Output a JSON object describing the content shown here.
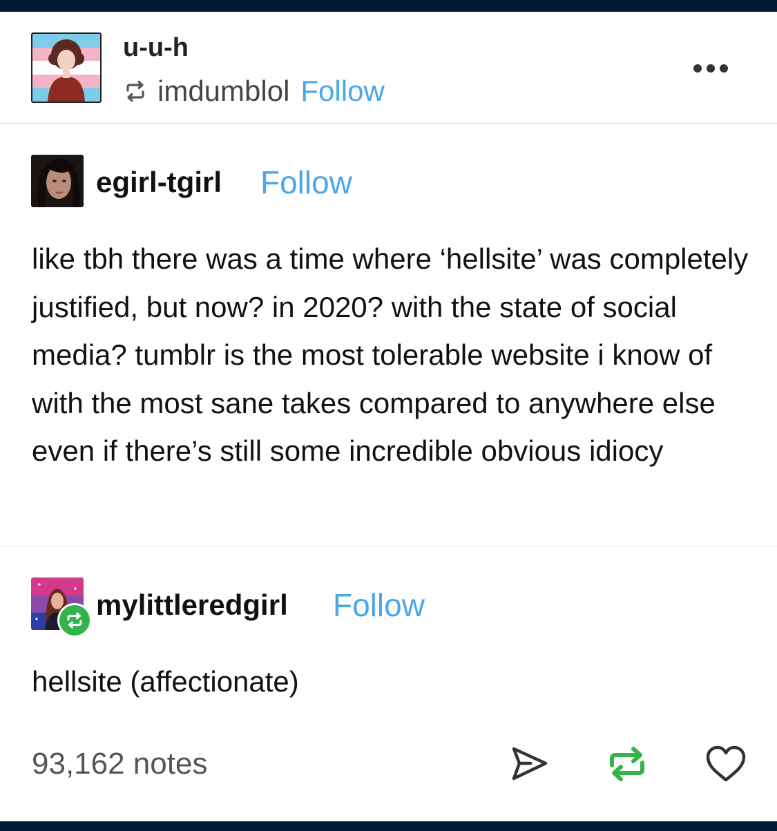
{
  "header": {
    "blog_name": "u-u-h",
    "reblogged_from": "imdumblol",
    "follow_label": "Follow"
  },
  "trail": [
    {
      "username": "egirl-tgirl",
      "follow_label": "Follow",
      "body": "like tbh there was a time where ‘hellsite’ was completely justified, but now? in 2020? with the state of social media? tumblr is the most tolerable website i know of with the most sane takes compared to anywhere else even if there’s still some incredible obvious idiocy"
    },
    {
      "username": "mylittleredgirl",
      "follow_label": "Follow",
      "body": "hellsite (affectionate)"
    }
  ],
  "footer": {
    "notes": "93,162 notes",
    "actions": [
      "share-icon",
      "reblog-icon",
      "like-icon"
    ]
  },
  "colors": {
    "nav_background": "#001935",
    "follow_link": "#4ba7e8",
    "reblog_green": "#33b44a",
    "divider": "#d4d4d4"
  }
}
